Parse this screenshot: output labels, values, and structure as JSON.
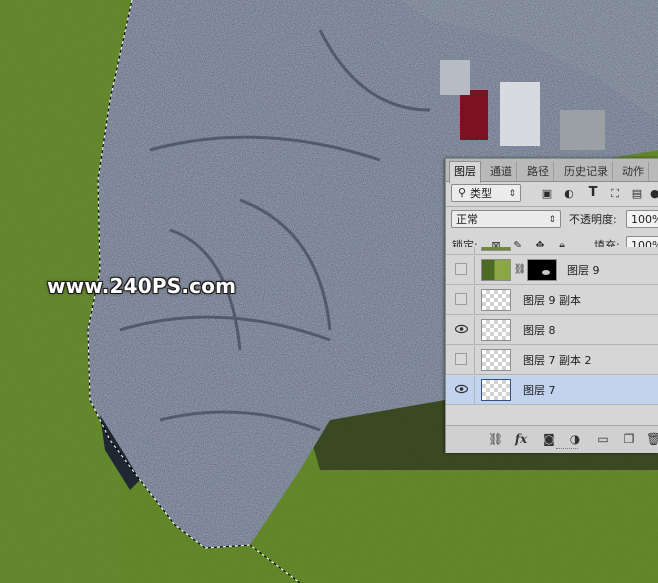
{
  "watermark": "www.240PS.com",
  "layers_panel": {
    "tabs": [
      "图层",
      "通道",
      "路径",
      "历史记录",
      "动作"
    ],
    "filter": {
      "search_icon": "search-icon",
      "type_label": "类型"
    },
    "blend_mode": "正常",
    "opacity_label": "不透明度:",
    "opacity_value": "100%",
    "lock_label": "锁定:",
    "fill_label": "填充:",
    "fill_value": "100%",
    "layers": [
      {
        "name": "图层 9",
        "visible": false,
        "has_mask": true,
        "selected": false
      },
      {
        "name": "图层 9 副本",
        "visible": false,
        "has_mask": false,
        "selected": false
      },
      {
        "name": "图层 8",
        "visible": true,
        "has_mask": false,
        "selected": false
      },
      {
        "name": "图层 7 副本 2",
        "visible": false,
        "has_mask": false,
        "selected": false
      },
      {
        "name": "图层 7",
        "visible": true,
        "has_mask": false,
        "selected": true
      }
    ],
    "colors": {
      "selected_row": "#c2d3ee",
      "panel_bg": "#d6d6d6"
    }
  }
}
